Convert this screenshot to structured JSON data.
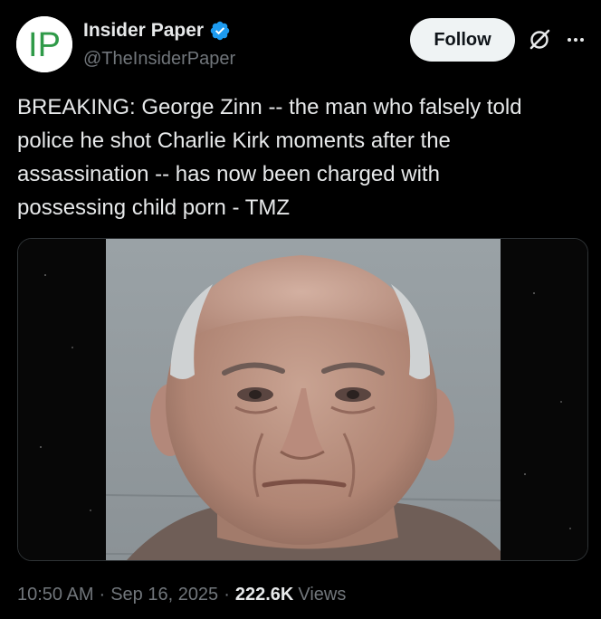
{
  "author": {
    "avatar_text": "IP",
    "display_name": "Insider Paper",
    "handle": "@TheInsiderPaper",
    "verified_icon": "verified-badge-icon"
  },
  "actions": {
    "follow_label": "Follow",
    "grok_icon": "grok-icon",
    "more_icon": "more-options-icon"
  },
  "tweet": {
    "text": "BREAKING: George Zinn -- the man who falsely told\npolice he shot Charlie Kirk moments after the\nassassination -- has now been charged with\npossessing child porn - TMZ"
  },
  "meta": {
    "time": "10:50 AM",
    "date": "Sep 16, 2025",
    "separator": "·",
    "views_count": "222.6K",
    "views_label": "Views"
  },
  "colors": {
    "background": "#000000",
    "text_primary": "#e7e9ea",
    "text_secondary": "#71767b",
    "verified": "#1d9bf0",
    "follow_bg": "#eff3f4",
    "avatar_green": "#2f9a48"
  }
}
